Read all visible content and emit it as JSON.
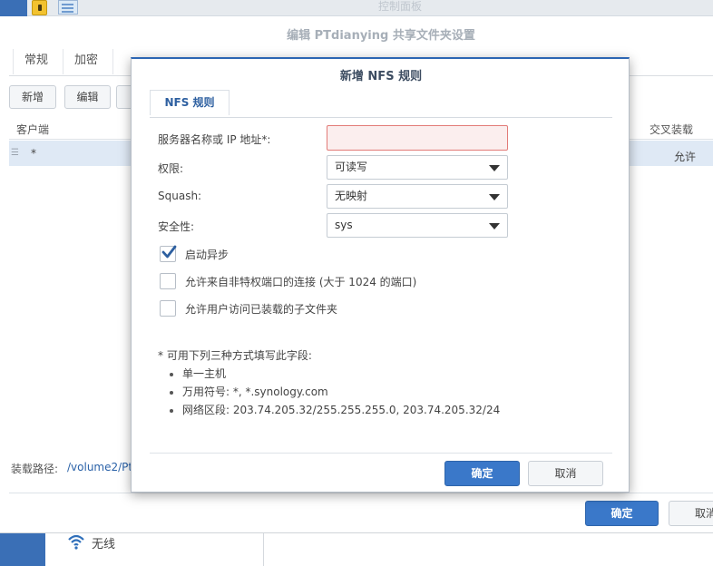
{
  "control_panel": {
    "title": "控制面板"
  },
  "share_window": {
    "title": "编辑 PTdianying 共享文件夹设置",
    "tabs": [
      "常规",
      "加密"
    ],
    "toolbar": {
      "add_label": "新增",
      "edit_label": "编辑"
    },
    "table": {
      "col_client": "客户端",
      "col_crossmnt": "交叉装载",
      "rows": [
        {
          "client": "*",
          "crossmnt": "允许"
        }
      ]
    },
    "mount_path_label": "装载路径:",
    "mount_path_value": "/volume2/Pt",
    "ok_label": "确定",
    "cancel_label": "取消"
  },
  "sidebar": {
    "wifi_label": "无线"
  },
  "dialog": {
    "title": "新增 NFS 规则",
    "tab": "NFS 规则",
    "fields": {
      "server_label": "服务器名称或 IP 地址*:",
      "server_value": "",
      "privilege_label": "权限:",
      "privilege_value": "可读写",
      "squash_label": "Squash:",
      "squash_value": "无映射",
      "security_label": "安全性:",
      "security_value": "sys"
    },
    "checkboxes": {
      "async_label": "启动异步",
      "async_checked": true,
      "nonpriv_label": "允许来自非特权端口的连接 (大于 1024 的端口)",
      "nonpriv_checked": false,
      "subdir_label": "允许用户访问已装载的子文件夹",
      "subdir_checked": false
    },
    "hint": {
      "title": "* 可用下列三种方式填写此字段:",
      "items": [
        "单一主机",
        "万用符号:  *, *.synology.com",
        "网络区段:  203.74.205.32/255.255.255.0, 203.74.205.32/24"
      ]
    },
    "ok_label": "确定",
    "cancel_label": "取消"
  },
  "colors": {
    "accent": "#3a78c9",
    "title_bar_blue": "#3a6fb6",
    "error_border": "#e27b78",
    "selected_row": "#dfe9f5"
  }
}
